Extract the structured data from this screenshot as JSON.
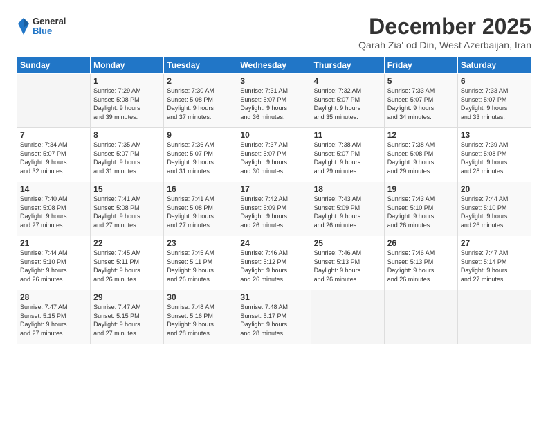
{
  "logo": {
    "general": "General",
    "blue": "Blue"
  },
  "title": "December 2025",
  "location": "Qarah Zia' od Din, West Azerbaijan, Iran",
  "days_header": [
    "Sunday",
    "Monday",
    "Tuesday",
    "Wednesday",
    "Thursday",
    "Friday",
    "Saturday"
  ],
  "weeks": [
    [
      {
        "day": "",
        "info": ""
      },
      {
        "day": "1",
        "info": "Sunrise: 7:29 AM\nSunset: 5:08 PM\nDaylight: 9 hours\nand 39 minutes."
      },
      {
        "day": "2",
        "info": "Sunrise: 7:30 AM\nSunset: 5:08 PM\nDaylight: 9 hours\nand 37 minutes."
      },
      {
        "day": "3",
        "info": "Sunrise: 7:31 AM\nSunset: 5:07 PM\nDaylight: 9 hours\nand 36 minutes."
      },
      {
        "day": "4",
        "info": "Sunrise: 7:32 AM\nSunset: 5:07 PM\nDaylight: 9 hours\nand 35 minutes."
      },
      {
        "day": "5",
        "info": "Sunrise: 7:33 AM\nSunset: 5:07 PM\nDaylight: 9 hours\nand 34 minutes."
      },
      {
        "day": "6",
        "info": "Sunrise: 7:33 AM\nSunset: 5:07 PM\nDaylight: 9 hours\nand 33 minutes."
      }
    ],
    [
      {
        "day": "7",
        "info": "Sunrise: 7:34 AM\nSunset: 5:07 PM\nDaylight: 9 hours\nand 32 minutes."
      },
      {
        "day": "8",
        "info": "Sunrise: 7:35 AM\nSunset: 5:07 PM\nDaylight: 9 hours\nand 31 minutes."
      },
      {
        "day": "9",
        "info": "Sunrise: 7:36 AM\nSunset: 5:07 PM\nDaylight: 9 hours\nand 31 minutes."
      },
      {
        "day": "10",
        "info": "Sunrise: 7:37 AM\nSunset: 5:07 PM\nDaylight: 9 hours\nand 30 minutes."
      },
      {
        "day": "11",
        "info": "Sunrise: 7:38 AM\nSunset: 5:07 PM\nDaylight: 9 hours\nand 29 minutes."
      },
      {
        "day": "12",
        "info": "Sunrise: 7:38 AM\nSunset: 5:08 PM\nDaylight: 9 hours\nand 29 minutes."
      },
      {
        "day": "13",
        "info": "Sunrise: 7:39 AM\nSunset: 5:08 PM\nDaylight: 9 hours\nand 28 minutes."
      }
    ],
    [
      {
        "day": "14",
        "info": "Sunrise: 7:40 AM\nSunset: 5:08 PM\nDaylight: 9 hours\nand 27 minutes."
      },
      {
        "day": "15",
        "info": "Sunrise: 7:41 AM\nSunset: 5:08 PM\nDaylight: 9 hours\nand 27 minutes."
      },
      {
        "day": "16",
        "info": "Sunrise: 7:41 AM\nSunset: 5:08 PM\nDaylight: 9 hours\nand 27 minutes."
      },
      {
        "day": "17",
        "info": "Sunrise: 7:42 AM\nSunset: 5:09 PM\nDaylight: 9 hours\nand 26 minutes."
      },
      {
        "day": "18",
        "info": "Sunrise: 7:43 AM\nSunset: 5:09 PM\nDaylight: 9 hours\nand 26 minutes."
      },
      {
        "day": "19",
        "info": "Sunrise: 7:43 AM\nSunset: 5:10 PM\nDaylight: 9 hours\nand 26 minutes."
      },
      {
        "day": "20",
        "info": "Sunrise: 7:44 AM\nSunset: 5:10 PM\nDaylight: 9 hours\nand 26 minutes."
      }
    ],
    [
      {
        "day": "21",
        "info": "Sunrise: 7:44 AM\nSunset: 5:10 PM\nDaylight: 9 hours\nand 26 minutes."
      },
      {
        "day": "22",
        "info": "Sunrise: 7:45 AM\nSunset: 5:11 PM\nDaylight: 9 hours\nand 26 minutes."
      },
      {
        "day": "23",
        "info": "Sunrise: 7:45 AM\nSunset: 5:11 PM\nDaylight: 9 hours\nand 26 minutes."
      },
      {
        "day": "24",
        "info": "Sunrise: 7:46 AM\nSunset: 5:12 PM\nDaylight: 9 hours\nand 26 minutes."
      },
      {
        "day": "25",
        "info": "Sunrise: 7:46 AM\nSunset: 5:13 PM\nDaylight: 9 hours\nand 26 minutes."
      },
      {
        "day": "26",
        "info": "Sunrise: 7:46 AM\nSunset: 5:13 PM\nDaylight: 9 hours\nand 26 minutes."
      },
      {
        "day": "27",
        "info": "Sunrise: 7:47 AM\nSunset: 5:14 PM\nDaylight: 9 hours\nand 27 minutes."
      }
    ],
    [
      {
        "day": "28",
        "info": "Sunrise: 7:47 AM\nSunset: 5:15 PM\nDaylight: 9 hours\nand 27 minutes."
      },
      {
        "day": "29",
        "info": "Sunrise: 7:47 AM\nSunset: 5:15 PM\nDaylight: 9 hours\nand 27 minutes."
      },
      {
        "day": "30",
        "info": "Sunrise: 7:48 AM\nSunset: 5:16 PM\nDaylight: 9 hours\nand 28 minutes."
      },
      {
        "day": "31",
        "info": "Sunrise: 7:48 AM\nSunset: 5:17 PM\nDaylight: 9 hours\nand 28 minutes."
      },
      {
        "day": "",
        "info": ""
      },
      {
        "day": "",
        "info": ""
      },
      {
        "day": "",
        "info": ""
      }
    ]
  ]
}
